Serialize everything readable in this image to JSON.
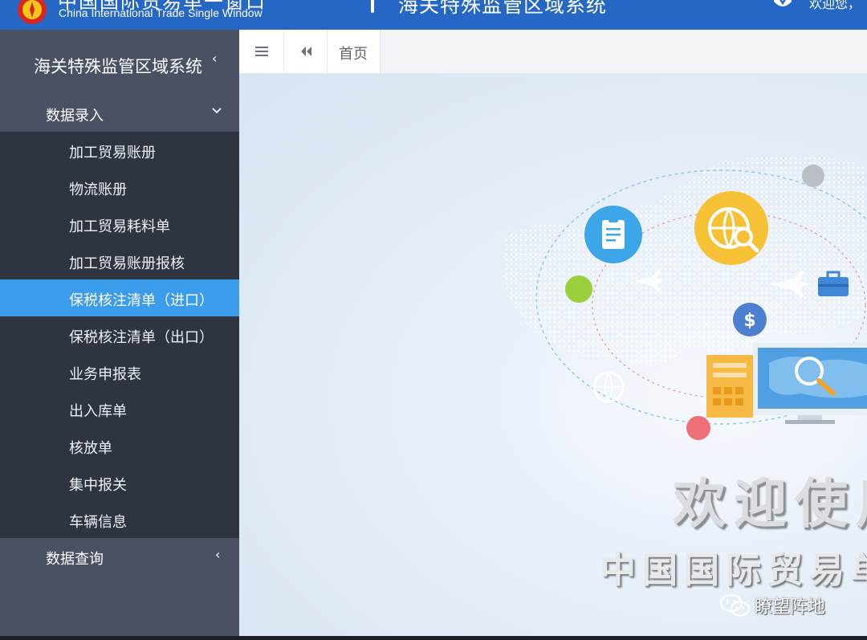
{
  "header": {
    "cn_title": "中国国际贸易单一窗口",
    "en_title": "China International Trade Single Window",
    "system_title": "海关特殊监管区域系统",
    "welcome": "欢迎您，"
  },
  "sidebar": {
    "title": "海关特殊监管区域系统",
    "collapse_glyph": "‹",
    "group_entry": "数据录入",
    "items": [
      {
        "label": "加工贸易账册"
      },
      {
        "label": "物流账册"
      },
      {
        "label": "加工贸易耗料单"
      },
      {
        "label": "加工贸易账册报核"
      },
      {
        "label": "保税核注清单（进口）"
      },
      {
        "label": "保税核注清单（出口）"
      },
      {
        "label": "业务申报表"
      },
      {
        "label": "出入库单"
      },
      {
        "label": "核放单"
      },
      {
        "label": "集中报关"
      },
      {
        "label": "车辆信息"
      }
    ],
    "active_index": 4,
    "group_query": "数据查询",
    "group_query_arrow": "‹"
  },
  "tabs": {
    "home_label": "首页"
  },
  "content": {
    "welcome_big": "欢迎使用",
    "welcome_sub": "中国国际贸易单一窗口",
    "watermark": "瞭望阵地"
  },
  "colors": {
    "header_blue": "#2567c4",
    "sidebar_dark": "#2f3441",
    "active_blue": "#3a9cea"
  }
}
